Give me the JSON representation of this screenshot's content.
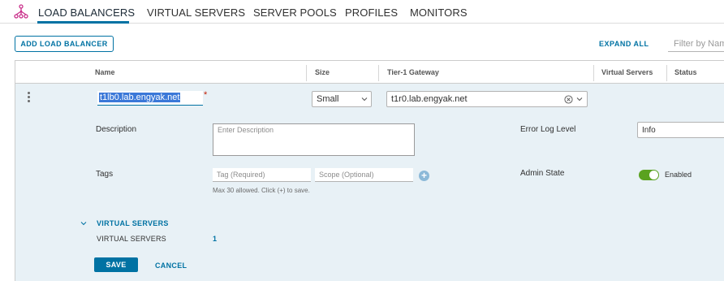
{
  "tabs": [
    {
      "label": "LOAD BALANCERS",
      "active": true
    },
    {
      "label": "VIRTUAL SERVERS",
      "active": false
    },
    {
      "label": "SERVER POOLS",
      "active": false
    },
    {
      "label": "PROFILES",
      "active": false
    },
    {
      "label": "MONITORS",
      "active": false
    }
  ],
  "toolbar": {
    "add_label": "ADD LOAD BALANCER",
    "expand_all_label": "EXPAND ALL",
    "filter_placeholder": "Filter by Name"
  },
  "columns": [
    "Name",
    "Size",
    "Tier-1 Gateway",
    "Virtual Servers",
    "Status"
  ],
  "row": {
    "name_value": "t1lb0.lab.engyak.net",
    "required_mark": "*",
    "size_value": "Small",
    "gateway_value": "t1r0.lab.engyak.net"
  },
  "form": {
    "description_label": "Description",
    "description_placeholder": "Enter Description",
    "tags_label": "Tags",
    "tag_placeholder": "Tag (Required)",
    "scope_placeholder": "Scope (Optional)",
    "tags_hint": "Max 30 allowed. Click (+) to save.",
    "error_log_label": "Error Log Level",
    "error_log_value": "Info",
    "admin_state_label": "Admin State",
    "admin_state_value": "Enabled",
    "admin_state_on": true
  },
  "virtual_servers": {
    "section_title": "VIRTUAL SERVERS",
    "label": "VIRTUAL SERVERS",
    "count": "1"
  },
  "actions": {
    "save_label": "SAVE",
    "cancel_label": "CANCEL"
  },
  "colors": {
    "accent": "#0072a3",
    "toggle_on": "#5aa220",
    "edit_row_bg": "#e8f1f6",
    "logo": "#c92f8a"
  },
  "icons": {
    "logo": "load-balancer-icon",
    "kebab": "vertical-ellipsis-icon",
    "clear": "close-circle-icon",
    "chevron": "chevron-down-icon",
    "add": "plus-circle-icon"
  }
}
